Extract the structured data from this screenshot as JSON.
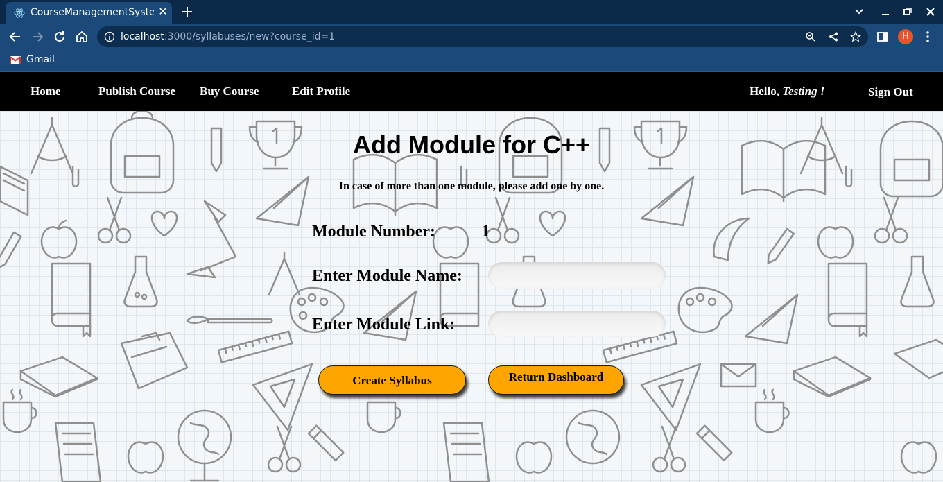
{
  "browser": {
    "tab_title": "CourseManagementSystem",
    "url_host": "localhost",
    "url_rest": ":3000/syllabuses/new?course_id=1",
    "profile_initial": "H",
    "bookmarks": [
      {
        "label": "Gmail",
        "icon": "gmail-icon"
      }
    ]
  },
  "nav": {
    "home": "Home",
    "publish_course": "Publish Course",
    "buy_course": "Buy Course",
    "edit_profile": "Edit Profile",
    "greeting_prefix": "Hello, ",
    "user_name": "Testing !",
    "sign_out": "Sign Out"
  },
  "form": {
    "title": "Add Module for C++",
    "hint": "In case of more than one module, please add one by one.",
    "module_number_label": "Module Number:",
    "module_number_value": "1",
    "module_name_label": "Enter Module Name:",
    "module_name_value": "",
    "module_link_label": "Enter Module Link:",
    "module_link_value": "",
    "create_button": "Create Syllabus",
    "return_button": "Return Dashboard"
  },
  "colors": {
    "browser_frame": "#0b2a4a",
    "browser_toolbar": "#1b4a7a",
    "navbar": "#000000",
    "button": "#ffa500",
    "avatar": "#e8542c"
  }
}
